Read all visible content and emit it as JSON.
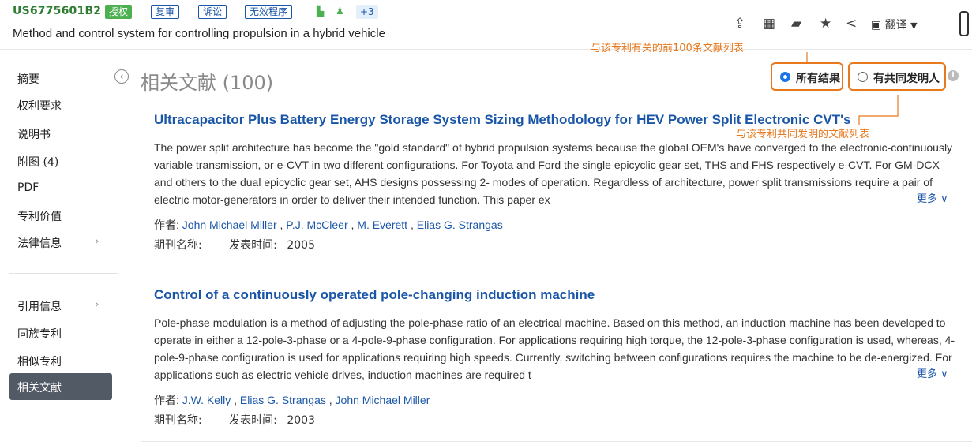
{
  "header": {
    "patent_number": "US6775601B2",
    "badges": [
      "授权",
      "复审",
      "诉讼",
      "无效程序",
      "+3"
    ],
    "title": "Method and control system for controlling propulsion in a hybrid vehicle",
    "toolbar": {
      "translate_label": "翻译"
    }
  },
  "annotations": {
    "top100": "与该专利有关的前100条文献列表",
    "coinventor": "与该专利共同发明的文献列表"
  },
  "sidebar": {
    "items": [
      "摘要",
      "权利要求",
      "说明书",
      "附图 (4)",
      "PDF",
      "专利价值",
      "法律信息"
    ],
    "items2": [
      "引用信息",
      "同族专利",
      "相似专利",
      "相关文献"
    ],
    "active": "相关文献"
  },
  "main": {
    "section_title": "相关文献 (100)",
    "filter": {
      "all_label": "所有结果",
      "co_label": "有共同发明人"
    },
    "more_label": "更多",
    "author_prefix": "作者:",
    "journal_label": "期刊名称:",
    "date_label": "发表时间:",
    "results": [
      {
        "title": "Ultracapacitor Plus Battery Energy Storage System Sizing Methodology for HEV Power Split Electronic CVT's",
        "abstract": "The power split architecture has become the \"gold standard\" of hybrid propulsion systems because the global OEM's have converged to the electronic-continuously variable transmission, or e-CVT in two different configurations. For Toyota and Ford the single epicyclic gear set, THS and FHS respectively e-CVT. For GM-DCX and others to the dual epicyclic gear set, AHS designs possessing 2- modes of operation. Regardless of architecture, power split transmissions require a pair of electric motor-generators in order to deliver their intended function. This paper ex",
        "authors": [
          "John Michael Miller",
          "P.J. McCleer",
          "M. Everett",
          "Elias G. Strangas"
        ],
        "year": "2005"
      },
      {
        "title": "Control of a continuously operated pole-changing induction machine",
        "abstract": "Pole-phase modulation is a method of adjusting the pole-phase ratio of an electrical machine. Based on this method, an induction machine has been developed to operate in either a 12-pole-3-phase or a 4-pole-9-phase configuration. For applications requiring high torque, the 12-pole-3-phase configuration is used, whereas, 4-pole-9-phase configuration is used for applications requiring high speeds. Currently, switching between configurations requires the machine to be de-energized. For applications such as electric vehicle drives, induction machines are required t",
        "authors": [
          "J.W. Kelly",
          "Elias G. Strangas",
          "John Michael Miller"
        ],
        "year": "2003"
      }
    ]
  },
  "colors": {
    "accent": "#1a56a8",
    "green": "#4caf50",
    "annotation": "#e8781c",
    "sidebar_active": "#525a66"
  }
}
